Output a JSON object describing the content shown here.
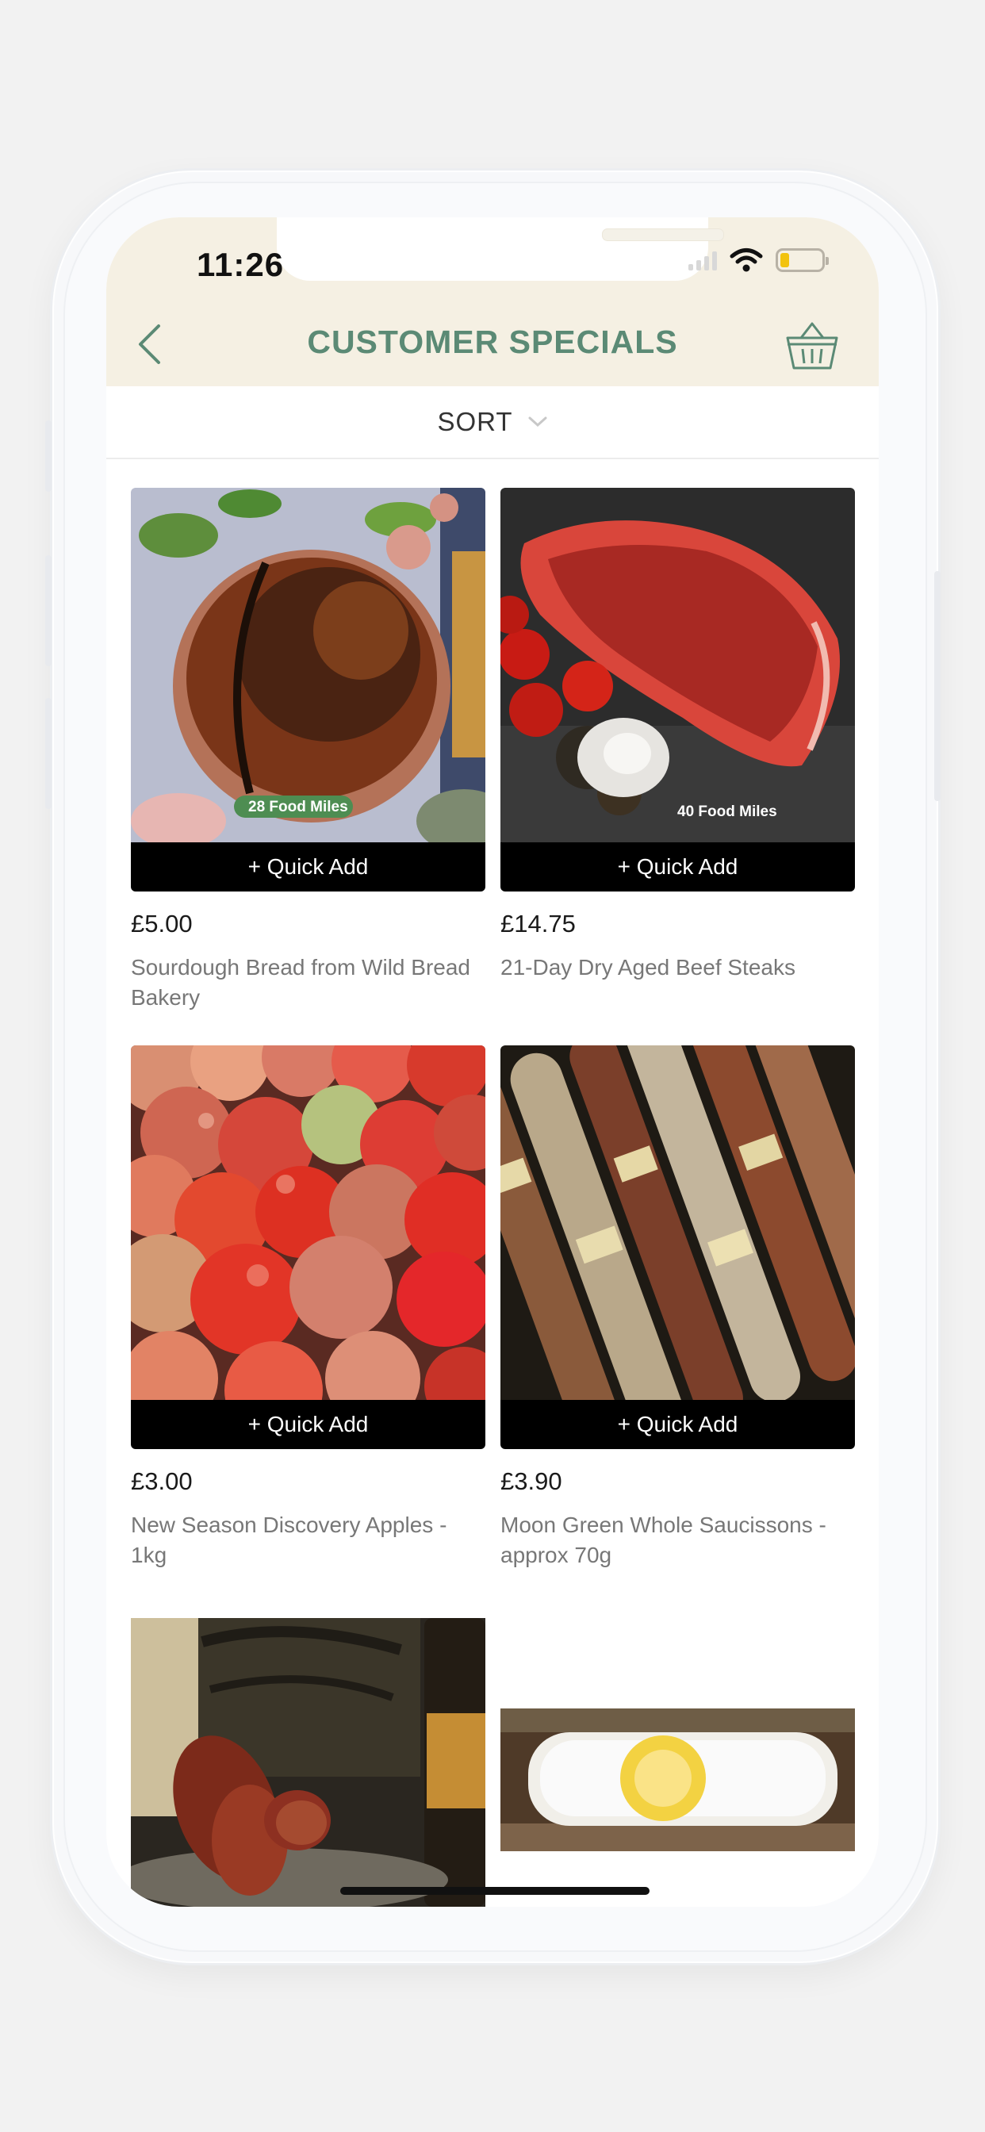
{
  "status_bar": {
    "time": "11:26"
  },
  "header": {
    "title": "CUSTOMER SPECIALS",
    "back_icon": "chevron-left-icon",
    "basket_icon": "basket-icon"
  },
  "sort": {
    "label": "SORT",
    "icon": "chevron-down-icon"
  },
  "products": [
    {
      "price": "£5.00",
      "name": "Sourdough Bread from Wild Bread Bakery",
      "badge": "28 Food Miles",
      "button": "+ Quick Add"
    },
    {
      "price": "£14.75",
      "name": "21-Day Dry Aged Beef Steaks",
      "badge": "40 Food Miles",
      "button": "+ Quick Add"
    },
    {
      "price": "£3.00",
      "name": "New Season Discovery Apples - 1kg",
      "button": "+ Quick Add"
    },
    {
      "price": "£3.90",
      "name": "Moon Green Whole Saucissons - approx 70g",
      "button": "+ Quick Add"
    }
  ],
  "colors": {
    "header_bg": "#f5f0e3",
    "accent_green": "#5b8a75",
    "button_bg": "#000000"
  }
}
